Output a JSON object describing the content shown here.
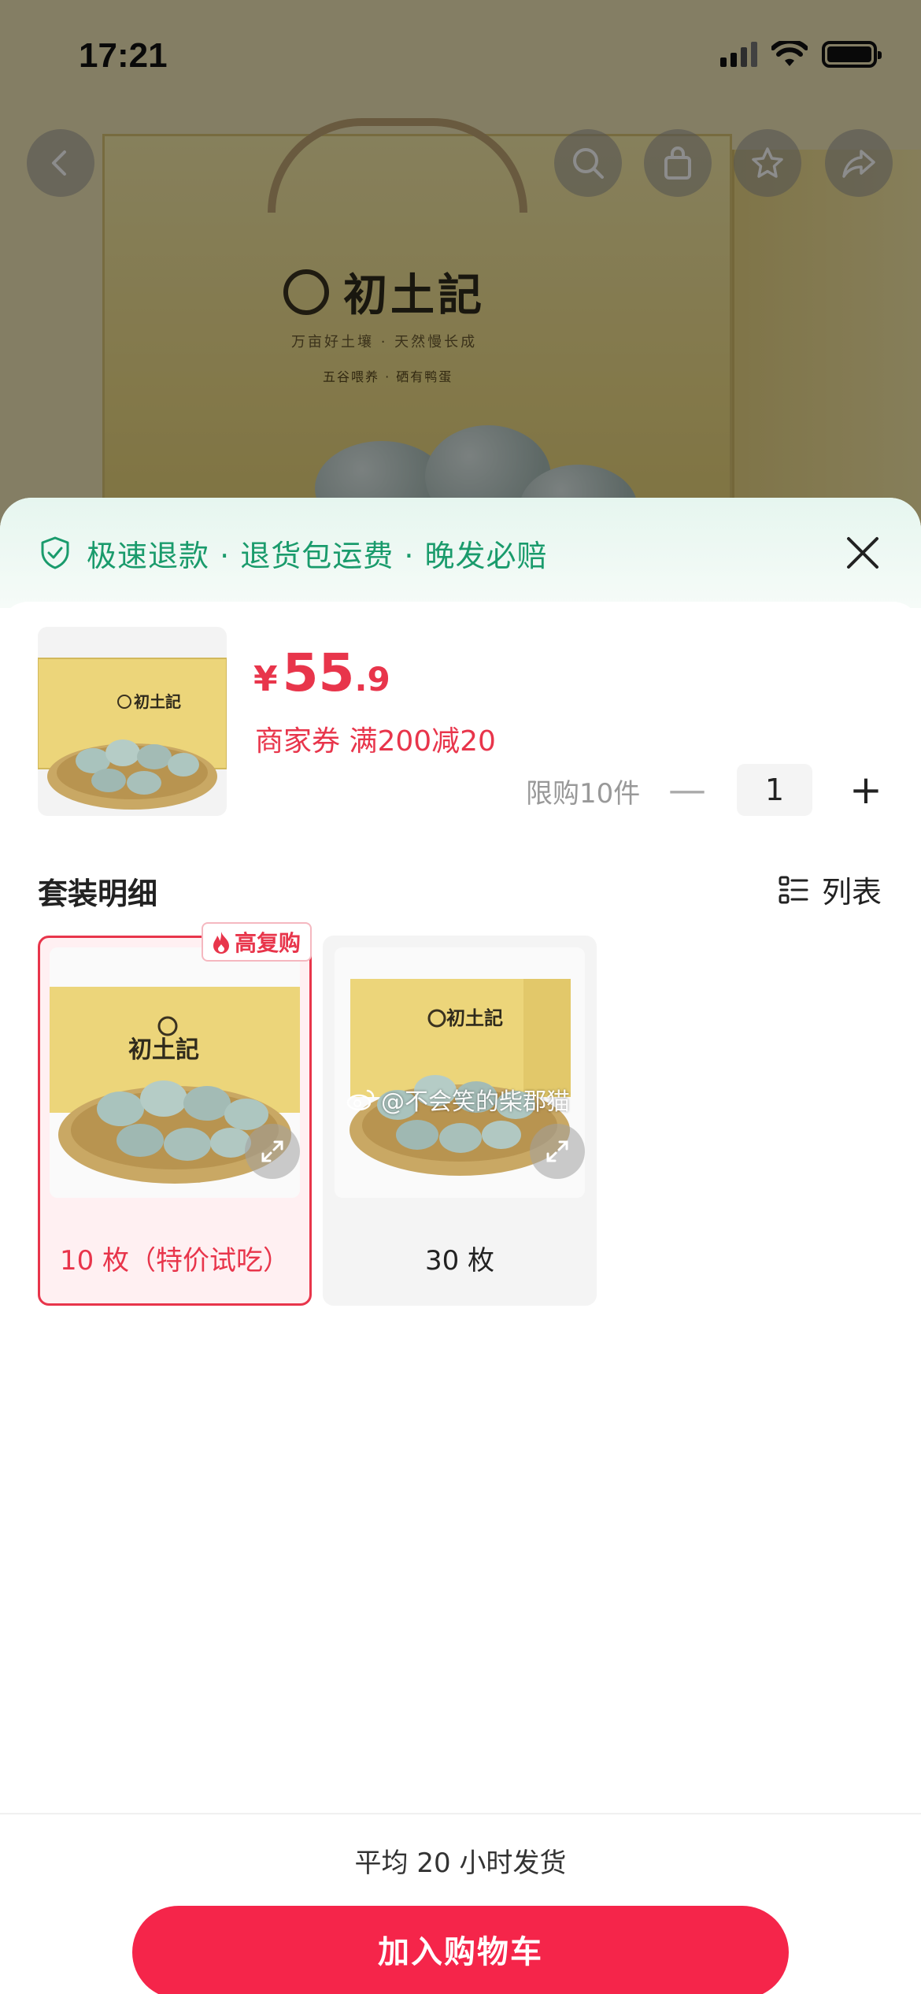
{
  "status_bar": {
    "time": "17:21"
  },
  "background_product": {
    "brand": "初土記",
    "slogan": "万亩好土壤 · 天然慢长成",
    "line2": "五谷喂养 · 硒有鸭蛋"
  },
  "guarantee": {
    "text": "极速退款 · 退货包运费 · 晚发必赔"
  },
  "product": {
    "price_currency": "¥",
    "price_integer": "55",
    "price_decimal": ".9",
    "coupon": "商家券 满200减20",
    "purchase_limit": "限购10件",
    "quantity": "1",
    "minus_label": "—",
    "plus_label": "+"
  },
  "section": {
    "title": "套装明细",
    "list_toggle_label": "列表"
  },
  "options": [
    {
      "label": "10 枚（特价试吃）",
      "badge": "高复购",
      "selected": true
    },
    {
      "label": "30 枚",
      "selected": false
    }
  ],
  "watermark": "@不会笑的柴郡猫",
  "shipping_note": "平均 20 小时发货",
  "add_to_cart_label": "加入购物车",
  "colors": {
    "accent_red": "#e8354b",
    "cta_red": "#f5254a",
    "guarantee_green": "#1a9b6c"
  },
  "icons": {
    "back": "chevron-left-icon",
    "search": "search-icon",
    "bag": "shopping-bag-icon",
    "favorite": "star-icon",
    "share": "share-icon",
    "guarantee": "shield-check-icon",
    "close": "close-icon",
    "list": "list-icon",
    "expand": "expand-icon",
    "fire": "fire-icon"
  }
}
